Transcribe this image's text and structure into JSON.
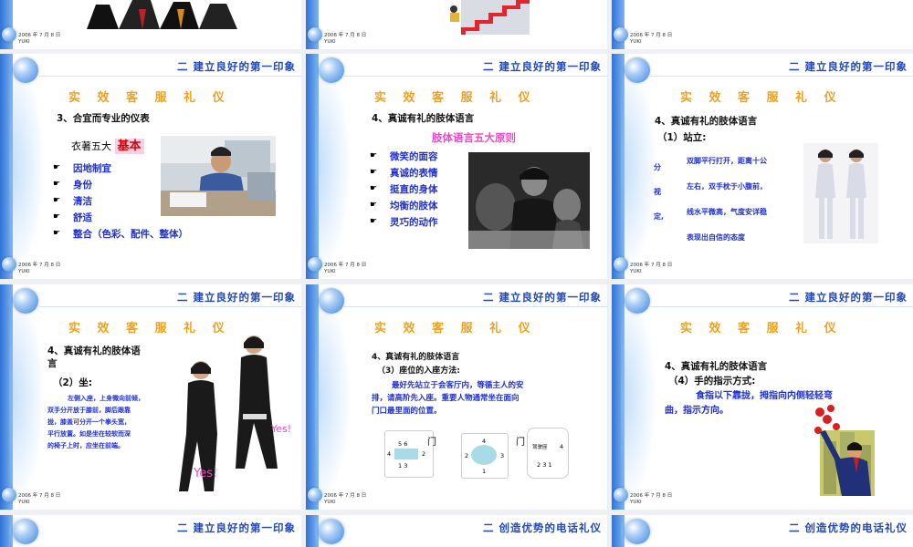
{
  "slides_top": [
    {
      "date": "2006 年 7 月 8 日",
      "author": "YUKI"
    },
    {
      "date": "2006 年 7 月 8 日",
      "author": "YUKI"
    },
    {
      "date": "2006 年 7 月 8 日",
      "author": "YUKI"
    }
  ],
  "header_first_impression": "二 建立良好的第一印象",
  "header_phone": "二 创造优势的电话礼仪",
  "subtitle": "实 效 客 服 礼 仪",
  "date": "2006 年 7 月 8 日",
  "author": "YUKI",
  "slide4": {
    "section": "3、合宜而专业的仪表",
    "five_label": "衣著五大",
    "five_highlight": "基本",
    "bullet_icon": "pointing-hand-icon",
    "items": [
      "因地制宜",
      "身份",
      "清洁",
      "舒适",
      "整合（色彩、配件、整体）"
    ]
  },
  "slide5": {
    "section": "4、真诚有礼的肢体语言",
    "principles_title": "肢体语言五大原则",
    "bullet_icon": "pointing-hand-icon",
    "items": [
      "微笑的面容",
      "真诚的表情",
      "挺直的身体",
      "均衡的肢体",
      "灵巧的动作"
    ]
  },
  "slide6": {
    "section": "4、真诚有礼的肢体语言",
    "sub": "（1）站立:",
    "left_chars": [
      "分",
      "视",
      "定,"
    ],
    "lines": [
      "双脚平行打开，距离十公",
      "左右，双手枕于小腹前，",
      "线水平微高，气度安详稳",
      "表现出自信的态度"
    ]
  },
  "slide7": {
    "section_line1": "4、真诚有礼的肢体语",
    "section_line2": "言",
    "sub": "（2）坐:",
    "lines": [
      "左侧入座，上身微向前倾，",
      "双手分开放于膝前，脚后跟靠",
      "拢，膝盖可分开一个拳头宽，",
      "平行放置。如是坐在较软而深",
      "的椅子上时，应坐在前端。"
    ],
    "yes": "Yes!"
  },
  "slide8": {
    "section": "4、真诚有礼的肢体语言",
    "sub": "（3）座位的入座方法:",
    "para_lines": [
      "最好先站立于会客厅内，等循主人的安",
      "排，请高阶先入座。重要人物通常坐在面向",
      "门口最里面的位置。"
    ],
    "door": "门",
    "d1": {
      "top": "5  6",
      "left": "4",
      "right": "2",
      "bottom": "1    3"
    },
    "d2": {
      "top": "4",
      "left": "2",
      "right": "3",
      "bottom": "1"
    },
    "d3": {
      "driver": "驾驶座",
      "right": "4",
      "bottom": "2  3  1"
    }
  },
  "slide9": {
    "section": "4、真诚有礼的肢体语言",
    "sub": "（4）手的指示方式:",
    "para_lines": [
      "食指以下靠拢，拇指向内侧轻轻弯",
      "曲，指示方向。"
    ]
  },
  "colors": {
    "accent_blue": "#1e2fd6",
    "header_blue": "#2148b8",
    "subtitle_orange": "#f0a020",
    "pink": "#f048c8",
    "highlight_red": "#d60000"
  }
}
